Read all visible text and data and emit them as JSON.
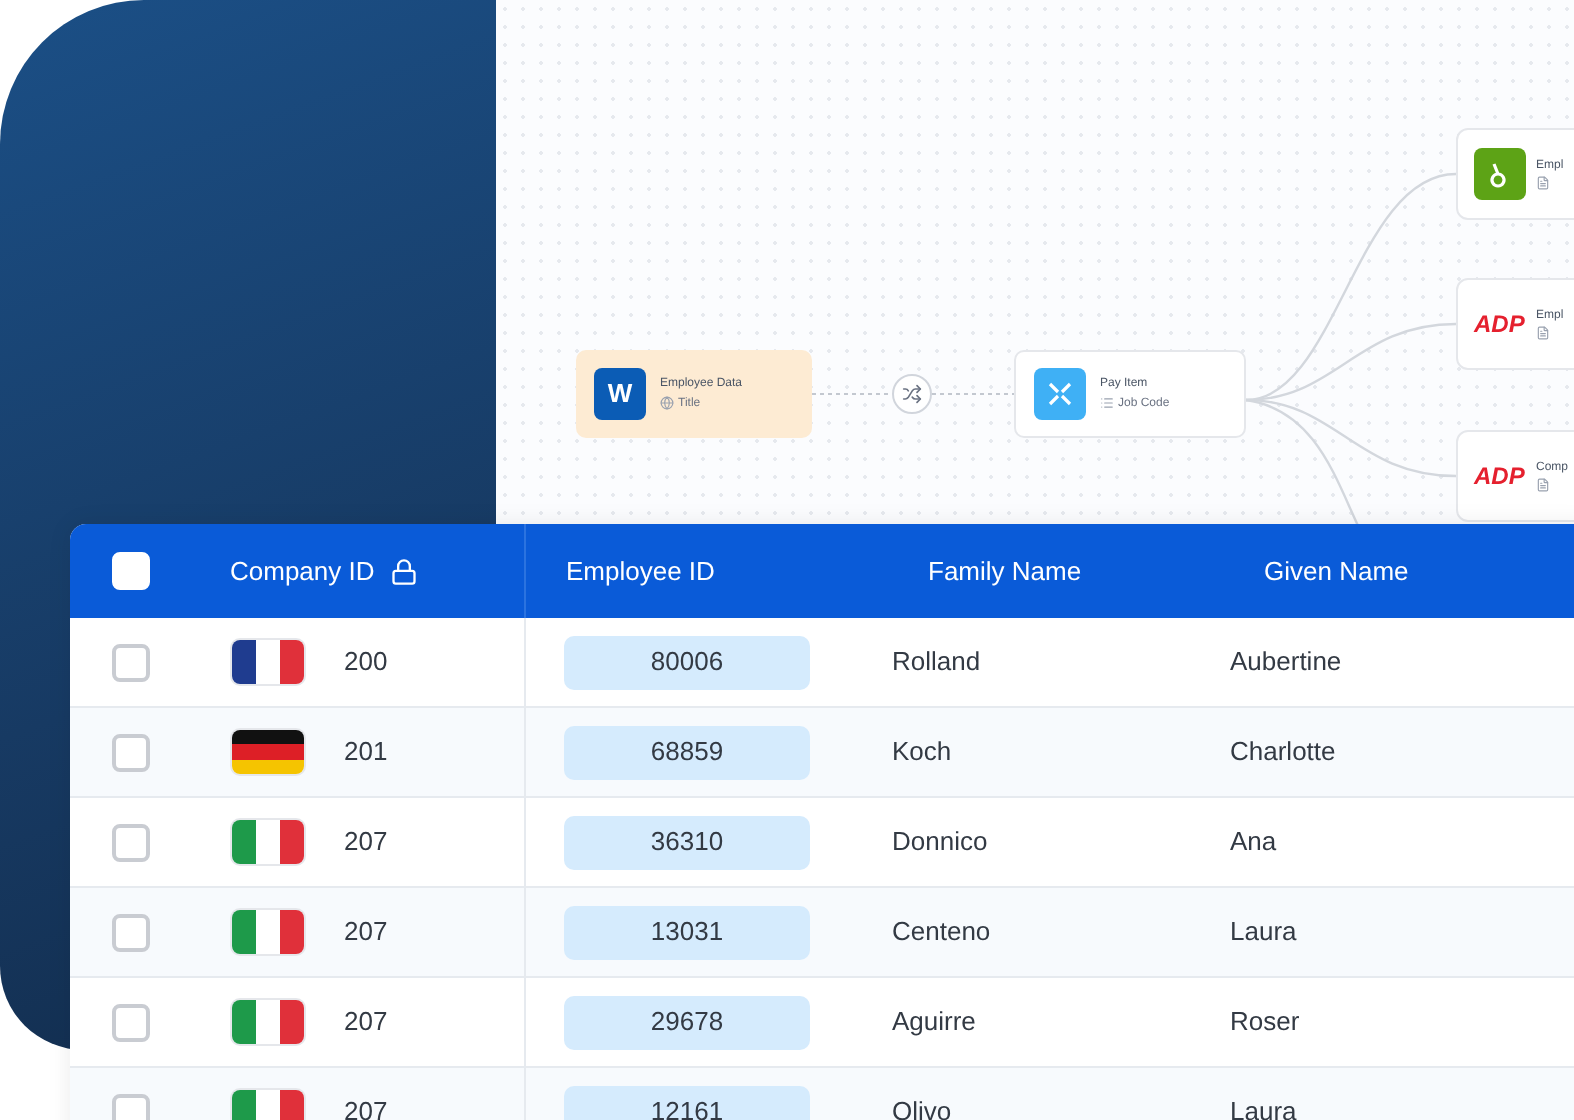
{
  "diagram": {
    "source": {
      "title": "Employee Data",
      "field": "Title",
      "logo_letter": "W"
    },
    "middle": {
      "title": "Pay Item",
      "field": "Job Code"
    },
    "targets": [
      {
        "kind": "bamboo",
        "title": "Empl"
      },
      {
        "kind": "adp",
        "logo_text": "ADP",
        "title": "Empl"
      },
      {
        "kind": "adp",
        "logo_text": "ADP",
        "title": "Comp"
      }
    ]
  },
  "table": {
    "header_checked": false,
    "columns": [
      "Company ID",
      "Employee ID",
      "Family Name",
      "Given Name"
    ],
    "rows": [
      {
        "checked": false,
        "kind": "fr",
        "company_id": "200",
        "employee_id": "80006",
        "family_name": "Rolland",
        "given_name": "Aubertine"
      },
      {
        "checked": false,
        "kind": "de",
        "company_id": "201",
        "employee_id": "68859",
        "family_name": "Koch",
        "given_name": "Charlotte"
      },
      {
        "checked": false,
        "kind": "it",
        "company_id": "207",
        "employee_id": "36310",
        "family_name": "Donnico",
        "given_name": "Ana"
      },
      {
        "checked": false,
        "kind": "it",
        "company_id": "207",
        "employee_id": "13031",
        "family_name": "Centeno",
        "given_name": "Laura"
      },
      {
        "checked": false,
        "kind": "it",
        "company_id": "207",
        "employee_id": "29678",
        "family_name": "Aguirre",
        "given_name": "Roser"
      },
      {
        "checked": false,
        "kind": "it",
        "company_id": "207",
        "employee_id": "12161",
        "family_name": "Olivo",
        "given_name": "Laura"
      }
    ]
  }
}
